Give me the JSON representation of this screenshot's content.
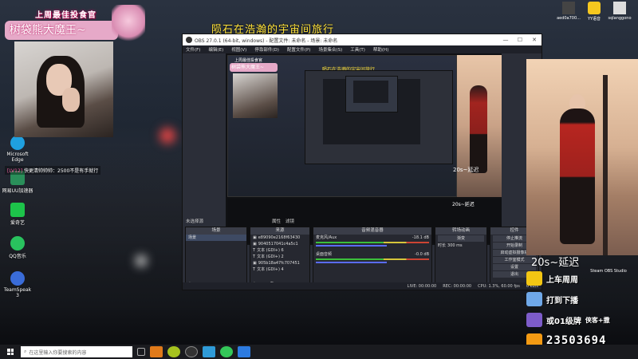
{
  "overlay": {
    "banner_title": "上周最佳投食官",
    "banner_name": "树袋熊大魔王~",
    "chat_level": "[LV12]",
    "chat_text": "快更清帅帅帅：2500不是有手就行",
    "center_title": "陨石在浩瀚的宇宙间旅行",
    "delay_left": "20s~延迟",
    "delay_right": "20s~延迟",
    "ov_rows": [
      "上车周周",
      "打到下播",
      "或01级牌",
      "侠客+撒"
    ],
    "room_id": "23503694"
  },
  "desktop_icons": [
    {
      "label": "Microsoft Edge",
      "color": "#1fa0e0"
    },
    {
      "label": "网易UU加速器",
      "color": "#2a8f5a"
    },
    {
      "label": "爱奇艺",
      "color": "#1dc34a"
    },
    {
      "label": "QQ音乐",
      "color": "#29c25e"
    },
    {
      "label": "TeamSpeak 3",
      "color": "#3a6cd8"
    }
  ],
  "topright_icons": [
    {
      "label": "aed0a700...",
      "color": "#444"
    },
    {
      "label": "YY语音",
      "color": "#f6c81f"
    },
    {
      "label": "sqlanggono",
      "color": "#ddd"
    }
  ],
  "obs": {
    "title": "OBS 27.0.1 (64-bit, windows) - 配置文件: 未命名 - 场景: 未命名",
    "menu": [
      "文件(F)",
      "编辑(E)",
      "视图(V)",
      "停靠部件(D)",
      "配置文件(P)",
      "场景集合(S)",
      "工具(T)",
      "帮助(H)"
    ],
    "toolbar_label": "未选择源",
    "toolbar_props": "属性",
    "toolbar_filters": "滤镜",
    "dock_scenes": "场景",
    "scene_item": "场景",
    "dock_sources": "来源",
    "sources": [
      "e89090e2168f63430",
      "9040517041c4a5c1",
      "文本 (GDI+) 6",
      "文本 (GDI+) 2",
      "905b18a47fc707451",
      "文本 (GDI+) 4"
    ],
    "dock_mixer": "音频混音器",
    "mixer_track1": "麦克风/Aux",
    "mixer_track1_db": "-18.1 dB",
    "mixer_track2": "桌面音频",
    "mixer_track2_db": "-0.0 dB",
    "dock_transitions": "转场动画",
    "transition_type": "渐变",
    "transition_duration": "300 ms",
    "duration_label": "时长",
    "dock_controls": "控件",
    "controls": [
      "停止推流",
      "开始录制",
      "启动虚拟摄像机",
      "工作室模式",
      "设置",
      "退出"
    ],
    "status": [
      "LIVE: 00:00:00",
      "REC: 00:00:00",
      "CPU: 1.3%, 60.00 fps",
      "0 kb/s"
    ]
  },
  "taskbar": {
    "search_placeholder": "在这里输入你要搜索的内容",
    "apps": [
      "#444",
      "#e07a1a",
      "#a6c31f",
      "#2f9bd8",
      "#34c759",
      "#2d7be0"
    ],
    "right_label": "Steam  OBS Studio"
  }
}
